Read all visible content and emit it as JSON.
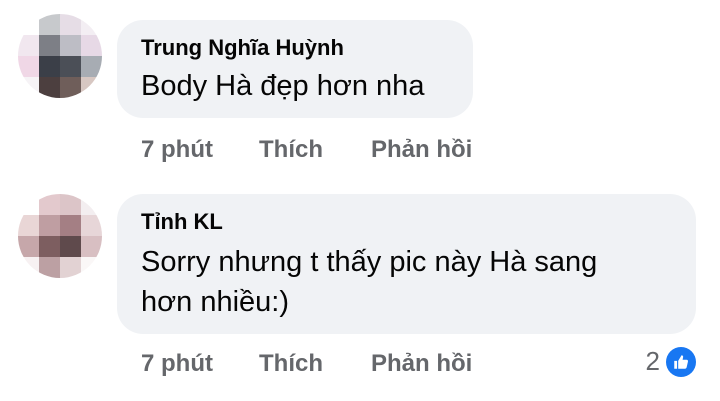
{
  "comments": [
    {
      "author": "Trung Nghĩa Huỳnh",
      "text": "Body Hà đẹp hơn nha",
      "time": "7 phút",
      "like_label": "Thích",
      "reply_label": "Phản hồi",
      "avatar_colors": [
        "#ffffff",
        "#c7c9cc",
        "#e6dde6",
        "#f3eef3",
        "#f1e7ef",
        "#7d7f86",
        "#bdbdc5",
        "#e7d9e6",
        "#f0d7e6",
        "#3b3f48",
        "#4b4f57",
        "#a7acb3",
        "#f6f3f6",
        "#4c3f3f",
        "#6f5e5a",
        "#d7c7c2"
      ]
    },
    {
      "author": "Tỉnh KL",
      "text_lines": [
        "Sorry nhưng t thấy pic này Hà sang",
        "hơn nhiều:)"
      ],
      "time": "7 phút",
      "like_label": "Thích",
      "reply_label": "Phản hồi",
      "reaction_count": "2",
      "reaction_icon": "thumbs-up-icon",
      "avatar_colors": [
        "#ffffff",
        "#e3c9cd",
        "#dcc5c8",
        "#f3eef0",
        "#e9d6d6",
        "#bf9ea2",
        "#a47f84",
        "#e7d6d8",
        "#c6a7aa",
        "#7d5e60",
        "#5f4a4c",
        "#d8bfc2",
        "#f7f1f2",
        "#bca0a3",
        "#e2d2d3",
        "#faf7f7"
      ]
    }
  ],
  "colors": {
    "bubble": "#f0f2f5",
    "action_text": "#65676b",
    "like_blue": "#1877f2"
  }
}
